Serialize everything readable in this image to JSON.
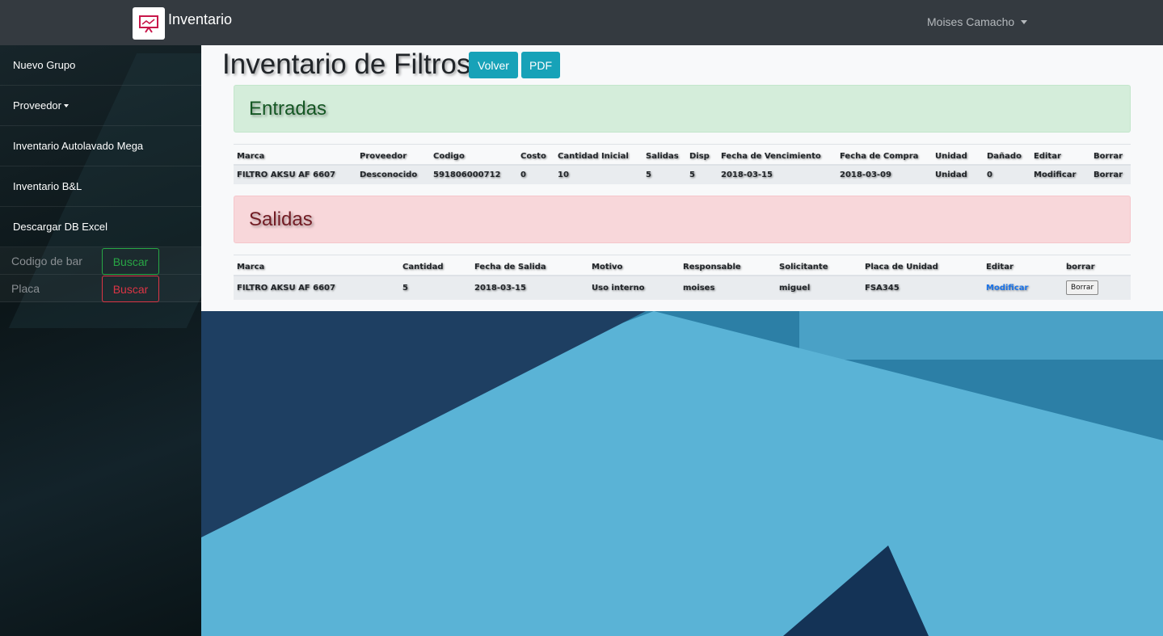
{
  "navbar": {
    "brand": "Inventario",
    "user": "Moises Camacho",
    "logo_icon": "presentation-chart-icon"
  },
  "sidebar": {
    "items": [
      {
        "label": "Nuevo Grupo"
      },
      {
        "label": "Proveedor"
      },
      {
        "label": "Inventario Autolavado Mega"
      },
      {
        "label": "Inventario B&L"
      },
      {
        "label": "Descargar DB Excel"
      }
    ],
    "search_barcode": {
      "placeholder": "Codigo de bar",
      "button": "Buscar"
    },
    "search_plate": {
      "placeholder": "Placa",
      "button": "Buscar"
    }
  },
  "main": {
    "title": "Inventario de Filtros",
    "volver": "Volver",
    "pdf": "PDF",
    "entradas": {
      "heading": "Entradas",
      "headers": [
        "Marca",
        "Proveedor",
        "Codigo",
        "Costo",
        "Cantidad Inicial",
        "Salidas",
        "Disp",
        "Fecha de Vencimiento",
        "Fecha de Compra",
        "Unidad",
        "Dañado",
        "Editar",
        "Borrar"
      ],
      "rows": [
        [
          "FILTRO AKSU AF 6607",
          "Desconocido",
          "591806000712",
          "0",
          "10",
          "5",
          "5",
          "2018-03-15",
          "2018-03-09",
          "Unidad",
          "0",
          "Modificar",
          "Borrar"
        ]
      ]
    },
    "salidas": {
      "heading": "Salidas",
      "headers": [
        "Marca",
        "Cantidad",
        "Fecha de Salida",
        "Motivo",
        "Responsable",
        "Solicitante",
        "Placa de Unidad",
        "Editar",
        "borrar"
      ],
      "rows": [
        [
          "FILTRO AKSU AF 6607",
          "5",
          "2018-03-15",
          "Uso interno",
          "moises",
          "miguel",
          "FSA345",
          "Modificar",
          "Borrar"
        ]
      ]
    }
  },
  "colors": {
    "navbar": "#343a40",
    "info": "#17a2b8",
    "success_bg": "#d4edda",
    "danger_bg": "#f8d7da",
    "green": "#28a745",
    "red": "#dc3545"
  }
}
